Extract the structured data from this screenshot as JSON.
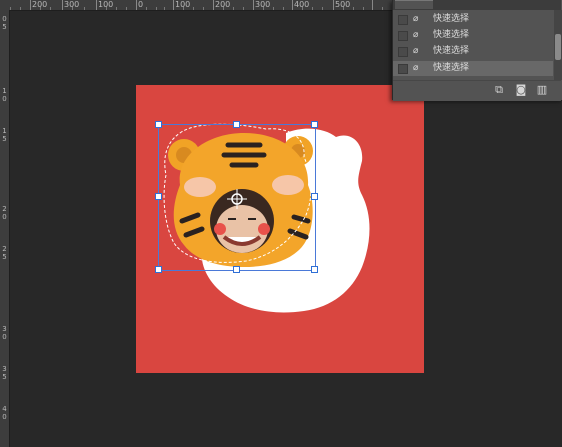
{
  "ruler": {
    "top_labels": [
      "200",
      "300",
      "100",
      "0",
      "100",
      "200",
      "300",
      "400",
      "500"
    ],
    "left_labels": [
      "0",
      "5",
      "1",
      "0",
      "1",
      "5",
      "2",
      "0",
      "2",
      "5",
      "3",
      "0",
      "3",
      "5",
      "4",
      "0"
    ]
  },
  "history_panel": {
    "items": [
      {
        "label": "快速选择",
        "selected": false
      },
      {
        "label": "快速选择",
        "selected": false
      },
      {
        "label": "快速选择",
        "selected": false
      },
      {
        "label": "快速选择",
        "selected": true
      }
    ],
    "footer_icons": [
      "new-snapshot-icon",
      "camera-icon",
      "trash-icon"
    ]
  },
  "colors": {
    "workspace": "#282828",
    "canvas": "#d94640",
    "panel": "#535353",
    "selection_box": "#4a79d8"
  }
}
